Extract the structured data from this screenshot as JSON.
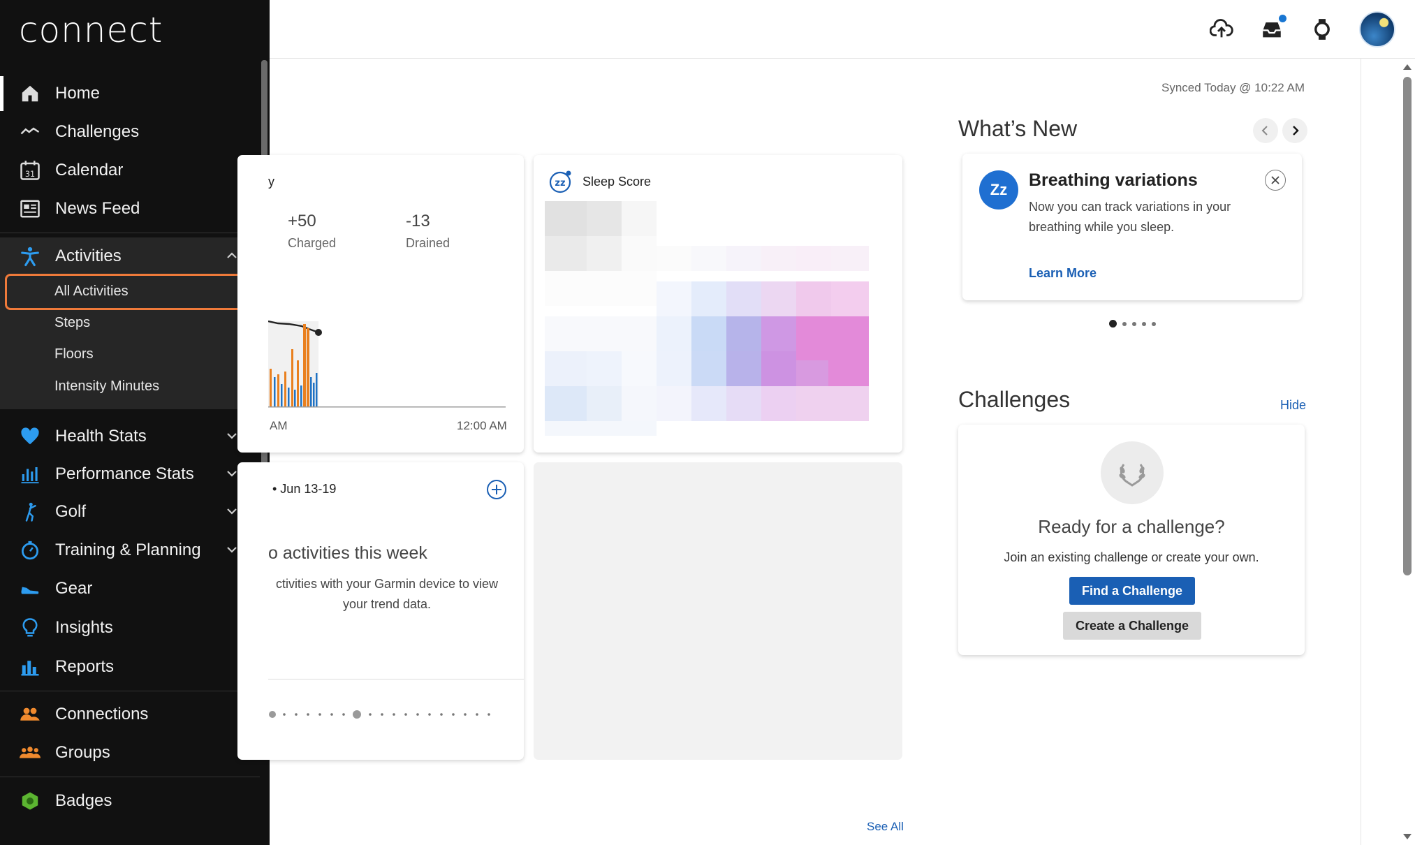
{
  "header": {
    "upload_icon": "cloud-upload-icon",
    "inbox_icon": "inbox-icon",
    "device_icon": "watch-icon",
    "avatar_icon": "avatar"
  },
  "sidebar": {
    "logo": "connect",
    "items": [
      {
        "label": "Home",
        "icon": "home-icon"
      },
      {
        "label": "Challenges",
        "icon": "challenges-icon"
      },
      {
        "label": "Calendar",
        "icon": "calendar-icon"
      },
      {
        "label": "News Feed",
        "icon": "news-feed-icon"
      },
      {
        "label": "Activities",
        "icon": "activities-icon"
      },
      {
        "label": "Health Stats",
        "icon": "heart-icon"
      },
      {
        "label": "Performance Stats",
        "icon": "performance-icon"
      },
      {
        "label": "Golf",
        "icon": "golf-icon"
      },
      {
        "label": "Training & Planning",
        "icon": "stopwatch-icon"
      },
      {
        "label": "Gear",
        "icon": "shoe-icon"
      },
      {
        "label": "Insights",
        "icon": "lightbulb-icon"
      },
      {
        "label": "Reports",
        "icon": "reports-icon"
      },
      {
        "label": "Connections",
        "icon": "connections-icon"
      },
      {
        "label": "Groups",
        "icon": "groups-icon"
      },
      {
        "label": "Badges",
        "icon": "badge-icon"
      }
    ],
    "activities_sub": [
      "All Activities",
      "Steps",
      "Floors",
      "Intensity Minutes"
    ],
    "calendar_day": "31"
  },
  "main": {
    "synced": "Synced Today @ 10:22 AM",
    "body_battery": {
      "title_fragment": "y",
      "charged_value": "+50",
      "charged_label": "Charged",
      "drained_value": "-13",
      "drained_label": "Drained",
      "axis_left": "AM",
      "axis_right": "12:00 AM"
    },
    "sleep": {
      "title": "Sleep Score",
      "icon_text": "zz"
    },
    "weekly": {
      "title": "• Jun 13-19",
      "no_activities": "o activities this week",
      "message_line1": "ctivities with your Garmin device to view",
      "message_line2": "your trend data."
    },
    "see_all": "See All"
  },
  "whats_new": {
    "title": "What’s New",
    "badge": "Zz",
    "headline": "Breathing variations",
    "body": "Now you can track variations in your breathing while you sleep.",
    "link": "Learn More"
  },
  "challenges": {
    "title": "Challenges",
    "hide": "Hide",
    "heading": "Ready for a challenge?",
    "sub": "Join an existing challenge or create your own.",
    "find": "Find a Challenge",
    "create": "Create a Challenge"
  },
  "colors": {
    "sidebar_bg": "#111111",
    "accent_blue": "#1a5fb4",
    "highlight": "#ef7a3a"
  }
}
